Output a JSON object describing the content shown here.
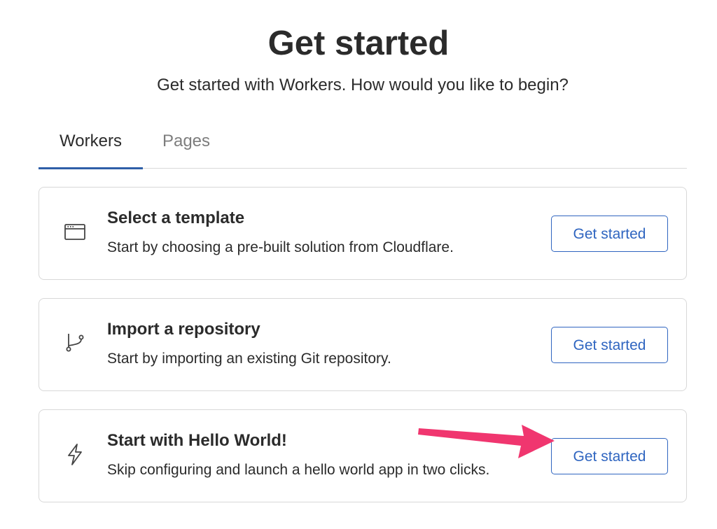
{
  "header": {
    "title": "Get started",
    "subtitle": "Get started with Workers. How would you like to begin?"
  },
  "tabs": [
    {
      "label": "Workers",
      "active": true
    },
    {
      "label": "Pages",
      "active": false
    }
  ],
  "cards": [
    {
      "icon": "browser-window-icon",
      "title": "Select a template",
      "description": "Start by choosing a pre-built solution from Cloudflare.",
      "button_label": "Get started"
    },
    {
      "icon": "git-branch-icon",
      "title": "Import a repository",
      "description": "Start by importing an existing Git repository.",
      "button_label": "Get started"
    },
    {
      "icon": "lightning-bolt-icon",
      "title": "Start with Hello World!",
      "description": "Skip configuring and launch a hello world app in two clicks.",
      "button_label": "Get started"
    }
  ],
  "annotation": {
    "type": "arrow",
    "color": "#f0366f",
    "points_to": "Start with Hello World! Get started button"
  },
  "colors": {
    "accent": "#2f65c0",
    "tab_underline": "#2f5fa8",
    "text": "#2b2b2b",
    "muted_text": "#7d7d7d",
    "border": "#d8d8d8"
  }
}
